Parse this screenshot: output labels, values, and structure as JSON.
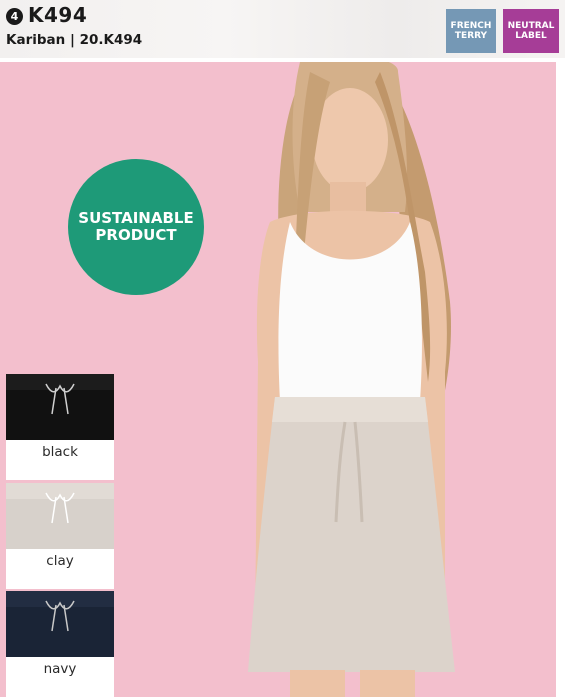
{
  "header": {
    "number": "4",
    "title": "K494",
    "subtitle": "Kariban | 20.K494"
  },
  "badges": {
    "french_terry": {
      "line1": "FRENCH",
      "line2": "TERRY",
      "color": "#7598b5"
    },
    "neutral_label": {
      "line1": "NEUTRAL",
      "line2": "LABEL",
      "color": "#a63d97"
    }
  },
  "sustainable": {
    "line1": "SUSTAINABLE",
    "line2": "PRODUCT",
    "color": "#1e9a78"
  },
  "photo": {
    "background_color": "#f3bfcd"
  },
  "colors": [
    {
      "label": "black",
      "swatch": "#111111"
    },
    {
      "label": "clay",
      "swatch": "#d7d1cb"
    },
    {
      "label": "navy",
      "swatch": "#1a2436"
    }
  ]
}
